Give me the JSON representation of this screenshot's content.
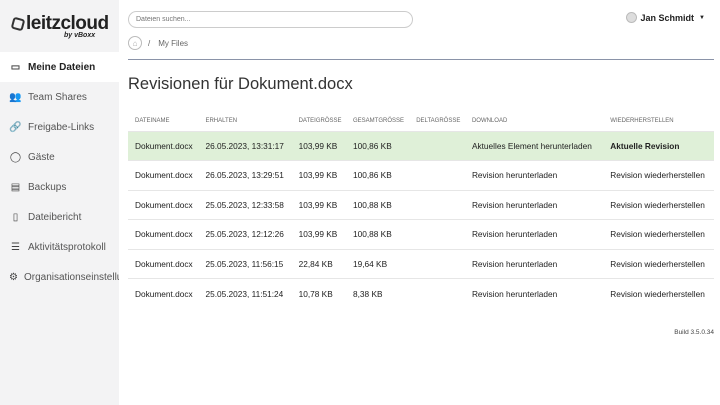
{
  "brand": {
    "name": "leitzcloud",
    "sub": "by vBoxx"
  },
  "sidebar": {
    "items": [
      {
        "label": "Meine Dateien",
        "icon": "folder-icon",
        "active": true
      },
      {
        "label": "Team Shares",
        "icon": "users-icon"
      },
      {
        "label": "Freigabe-Links",
        "icon": "link-icon"
      },
      {
        "label": "Gäste",
        "icon": "user-icon"
      },
      {
        "label": "Backups",
        "icon": "backup-icon"
      },
      {
        "label": "Dateibericht",
        "icon": "report-icon"
      },
      {
        "label": "Aktivitätsprotokoll",
        "icon": "activity-log-icon"
      },
      {
        "label": "Organisationseinstellungen",
        "icon": "gear-icon"
      }
    ]
  },
  "search": {
    "placeholder": "Dateien suchen..."
  },
  "user": {
    "name": "Jan Schmidt"
  },
  "breadcrumb": {
    "sep": "/",
    "current": "My Files"
  },
  "page": {
    "title": "Revisionen für Dokument.docx"
  },
  "table": {
    "headers": [
      "DATEINAME",
      "ERHALTEN",
      "DATEIGRÖSSE",
      "GESAMTGRÖSSE",
      "DELTAGRÖSSE",
      "DOWNLOAD",
      "WIEDERHERSTELLEN"
    ],
    "rows": [
      [
        "Dokument.docx",
        "26.05.2023, 13:31:17",
        "103,99 KB",
        "100,86 KB",
        "",
        "Aktuelles Element herunterladen",
        "Aktuelle Revision"
      ],
      [
        "Dokument.docx",
        "26.05.2023, 13:29:51",
        "103,99 KB",
        "100,86 KB",
        "",
        "Revision herunterladen",
        "Revision wiederherstellen"
      ],
      [
        "Dokument.docx",
        "25.05.2023, 12:33:58",
        "103,99 KB",
        "100,88 KB",
        "",
        "Revision herunterladen",
        "Revision wiederherstellen"
      ],
      [
        "Dokument.docx",
        "25.05.2023, 12:12:26",
        "103,99 KB",
        "100,88 KB",
        "",
        "Revision herunterladen",
        "Revision wiederherstellen"
      ],
      [
        "Dokument.docx",
        "25.05.2023, 11:56:15",
        "22,84 KB",
        "19,64 KB",
        "",
        "Revision herunterladen",
        "Revision wiederherstellen"
      ],
      [
        "Dokument.docx",
        "25.05.2023, 11:51:24",
        "10,78 KB",
        "8,38 KB",
        "",
        "Revision herunterladen",
        "Revision wiederherstellen"
      ]
    ]
  },
  "footer": {
    "build": "Build 3.5.0.34"
  }
}
